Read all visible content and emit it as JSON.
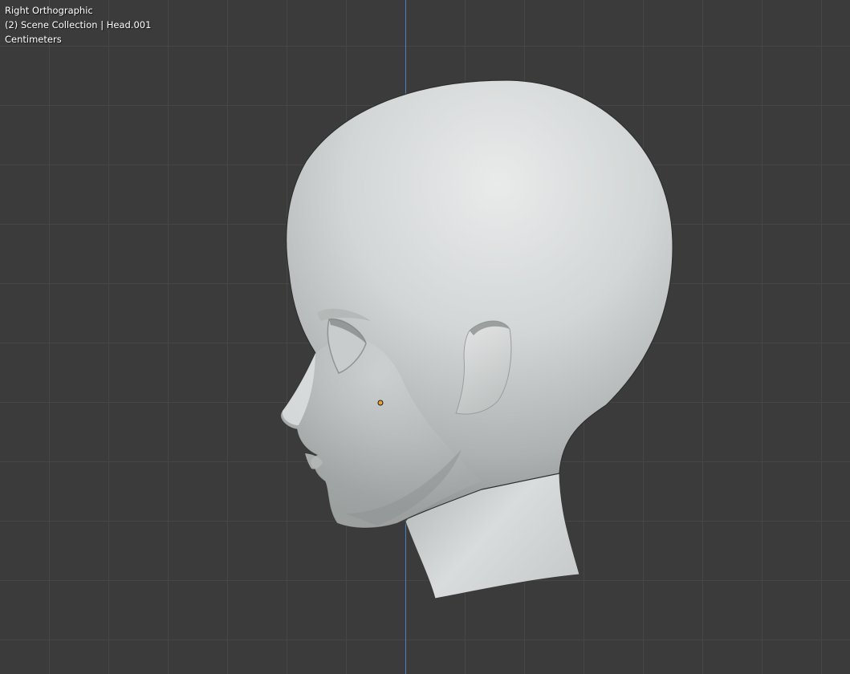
{
  "viewport": {
    "view_name": "Right Orthographic",
    "collection_info": "(2) Scene Collection | Head.001",
    "units": "Centimeters"
  },
  "colors": {
    "background": "#3b3b3b",
    "grid_line": "#464646",
    "z_axis": "#4a7fc9",
    "mesh_light": "#e6e8e8",
    "mesh_shadow": "#8d9291",
    "object_origin": "#f0a12b"
  },
  "scene": {
    "active_object": "Head.001",
    "shading": "solid"
  }
}
